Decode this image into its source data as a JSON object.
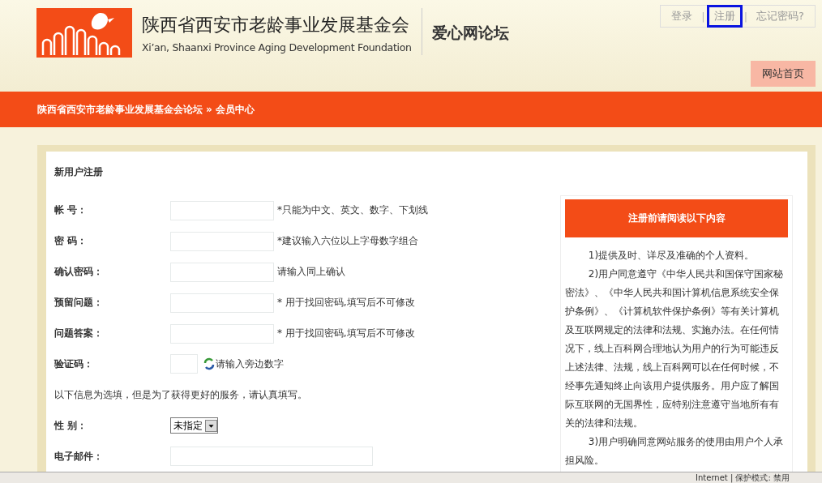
{
  "header": {
    "title": "陕西省西安市老龄事业发展基金会",
    "subtitle": "Xi’an, Shaanxi Province Aging Development Foundation",
    "forum_name": "爱心网论坛",
    "link_separator": "|",
    "top_links": [
      {
        "label": "登录",
        "selected": false
      },
      {
        "label": "注册",
        "selected": true
      },
      {
        "label": "忘记密码?",
        "selected": false
      }
    ],
    "home_button": "网站首页"
  },
  "breadcrumb": {
    "root": "陕西省西安市老龄事业发展基金会论坛",
    "separator": "»",
    "current": "会员中心"
  },
  "form": {
    "title": "新用户注册",
    "fields": [
      {
        "kind": "text",
        "label": "帐 号：",
        "hint": "*只能为中文、英文、数字、下划线"
      },
      {
        "kind": "text",
        "label": "密 码：",
        "hint": "*建议输入六位以上字母数字组合"
      },
      {
        "kind": "text",
        "label": "确认密码：",
        "hint": "请输入同上确认"
      },
      {
        "kind": "text",
        "label": "预留问题：",
        "hint": "* 用于找回密码,填写后不可修改"
      },
      {
        "kind": "text",
        "label": "问题答案：",
        "hint": "* 用于找回密码,填写后不可修改"
      },
      {
        "kind": "captcha",
        "label": "验证码：",
        "hint": "请输入旁边数字"
      },
      {
        "kind": "note",
        "label": "以下信息为选填，但是为了获得更好的服务，请认真填写。"
      },
      {
        "kind": "select",
        "label": "性 别：",
        "value": "未指定"
      },
      {
        "kind": "email",
        "label": "电子邮件："
      }
    ]
  },
  "notice": {
    "title": "注册前请阅读以下内容",
    "paragraphs": [
      "1)提供及时、详尽及准确的个人资料。",
      "2)用户同意遵守《中华人民共和国保守国家秘密法》、《中华人民共和国计算机信息系统安全保护条例》、《计算机软件保护条例》等有关计算机及互联网规定的法律和法规、实施办法。在任何情况下，线上百科网合理地认为用户的行为可能违反上述法律、法规，线上百科网可以在任何时候，不经事先通知终止向该用户提供服务。用户应了解国际互联网的无国界性，应特别注意遵守当地所有有关的法律和法规。",
      "3)用户明确同意网站服务的使用由用户个人承担风险。"
    ]
  },
  "status_bar": {
    "zone": "Internet | 保护模式: 禁用"
  }
}
